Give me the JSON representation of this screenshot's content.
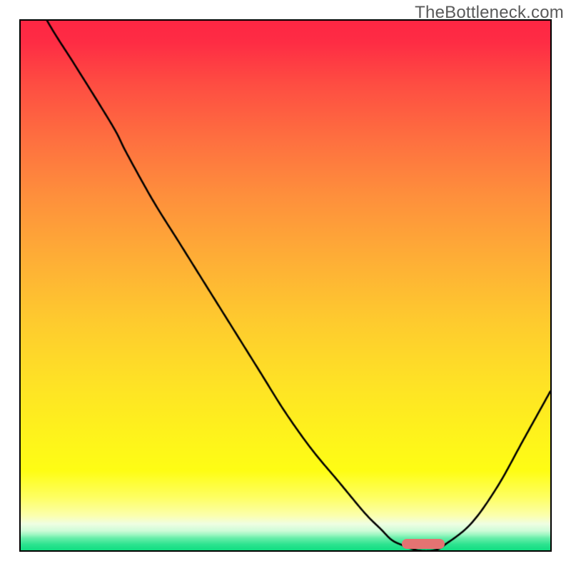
{
  "watermark": "TheBottleneck.com",
  "plot": {
    "inner_w": 742,
    "inner_h": 742
  },
  "colors": {
    "curve": "#000000",
    "marker": "#e47372",
    "border": "#000000"
  },
  "chart_data": {
    "type": "line",
    "title": "",
    "xlabel": "",
    "ylabel": "",
    "xlim": [
      0,
      100
    ],
    "ylim": [
      0,
      100
    ],
    "x": [
      0,
      5,
      10,
      15,
      18,
      20,
      25,
      30,
      35,
      40,
      45,
      50,
      55,
      60,
      65,
      68,
      70,
      72,
      75,
      78,
      80,
      85,
      90,
      95,
      100
    ],
    "values": [
      110,
      100,
      92,
      84,
      79,
      75,
      66,
      58,
      50,
      42,
      34,
      26,
      19,
      13,
      7,
      4,
      2,
      1,
      0,
      0,
      1,
      5,
      12,
      21,
      30
    ],
    "series": [
      {
        "name": "curve",
        "x_ref": "x",
        "values_ref": "values"
      }
    ],
    "marker": {
      "x_start": 72,
      "x_end": 80,
      "y": 0.5,
      "label": ""
    },
    "notes": "x axis domain 0–100 (arbitrary units), y axis 0–100 bottleneck-severity scale (0 = optimal, 100 = severe). Curve descends from top-left, reaches minimum ~x=75, rises toward right. Red pill marks optimum band on x axis."
  }
}
